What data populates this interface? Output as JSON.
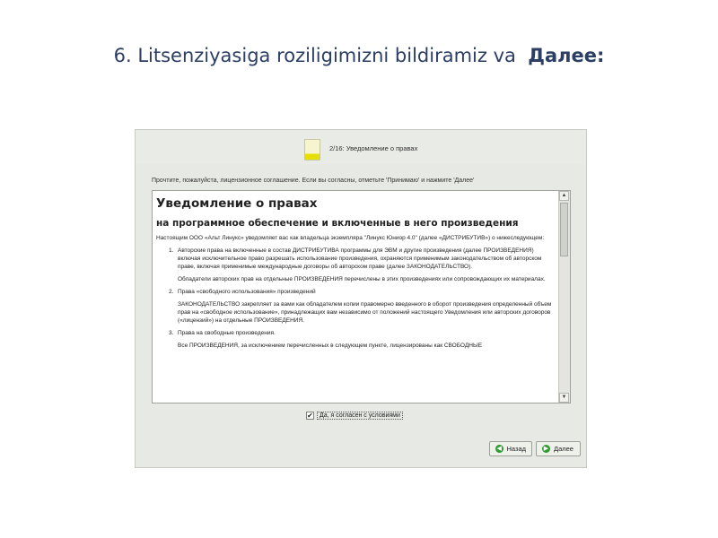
{
  "slide": {
    "title_main": "6. Litsenziyasiga roziligimizni bildiramiz va",
    "title_bold": "Далее:"
  },
  "installer": {
    "step_title": "2/16: Уведомление о правах",
    "instruction": "Прочтите, пожалуйста, лицензионное соглашение. Если вы согласны, отметьте 'Принимаю' и нажмите 'Далее'",
    "license": {
      "heading": "Уведомление о правах",
      "subheading": "на программное обеспечение и включенные в него произведения",
      "intro": "Настоящим ООО «Альт Линукс» уведомляет вас как владельца экземпляра \"Линукс Юниор 4.0\" (далее «ДИСТРИБУТИВ») о нижеследующем:",
      "items": [
        {
          "num": "1.",
          "text": "Авторские права на включенные в состав ДИСТРИБУТИВА программы для ЭВМ и другие произведения (далее ПРОИЗВЕДЕНИЯ) включая исключительное право разрешать использование произведения, охраняются применимым законодательством об авторском праве, включая применимые международные договоры об авторском праве (далее ЗАКОНОДАТЕЛЬСТВО)."
        },
        {
          "num": "",
          "text": "Обладатели авторских прав на отдельные ПРОИЗВЕДЕНИЯ перечислены в этих произведениях или сопровождающих их материалах."
        },
        {
          "num": "2.",
          "text": "Права «свободного использования» произведений"
        },
        {
          "num": "",
          "text": "ЗАКОНОДАТЕЛЬСТВО закрепляет за вами как обладателем копии правомерно введенного в оборот произведения определенный объем прав на «свободное использование», принадлежащих вам независимо от положений настоящего Уведомления или авторских договоров («лицензий») на отдельные ПРОИЗВЕДЕНИЯ."
        },
        {
          "num": "3.",
          "text": "Права на свободные произведения."
        },
        {
          "num": "",
          "text": "Все ПРОИЗВЕДЕНИЯ, за исключением перечисленных в следующем пункте, лицензированы как СВОБОДНЫЕ"
        }
      ]
    },
    "agree_checked": "✔",
    "agree_label": "Да, я согласен с условиями",
    "back_label": "Назад",
    "next_label": "Далее",
    "scroll_up_glyph": "▲",
    "scroll_down_glyph": "▼",
    "back_icon_glyph": "◀",
    "next_icon_glyph": "▶",
    "accent_color": "#2f9a2f",
    "title_color": "#2c3e63"
  }
}
